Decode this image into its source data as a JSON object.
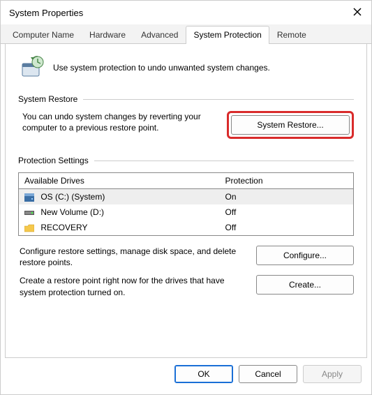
{
  "window": {
    "title": "System Properties"
  },
  "tabs": {
    "t0": "Computer Name",
    "t1": "Hardware",
    "t2": "Advanced",
    "t3": "System Protection",
    "t4": "Remote"
  },
  "intro": "Use system protection to undo unwanted system changes.",
  "sections": {
    "restore": "System Restore",
    "protection": "Protection Settings"
  },
  "restore": {
    "text": "You can undo system changes by reverting your computer to a previous restore point.",
    "button": "System Restore..."
  },
  "driveTable": {
    "colDrive": "Available Drives",
    "colProt": "Protection",
    "rows": [
      {
        "name": "OS (C:) (System)",
        "prot": "On"
      },
      {
        "name": "New Volume (D:)",
        "prot": "Off"
      },
      {
        "name": "RECOVERY",
        "prot": "Off"
      }
    ]
  },
  "configure": {
    "text": "Configure restore settings, manage disk space, and delete restore points.",
    "button": "Configure..."
  },
  "create": {
    "text": "Create a restore point right now for the drives that have system protection turned on.",
    "button": "Create..."
  },
  "footer": {
    "ok": "OK",
    "cancel": "Cancel",
    "apply": "Apply"
  }
}
